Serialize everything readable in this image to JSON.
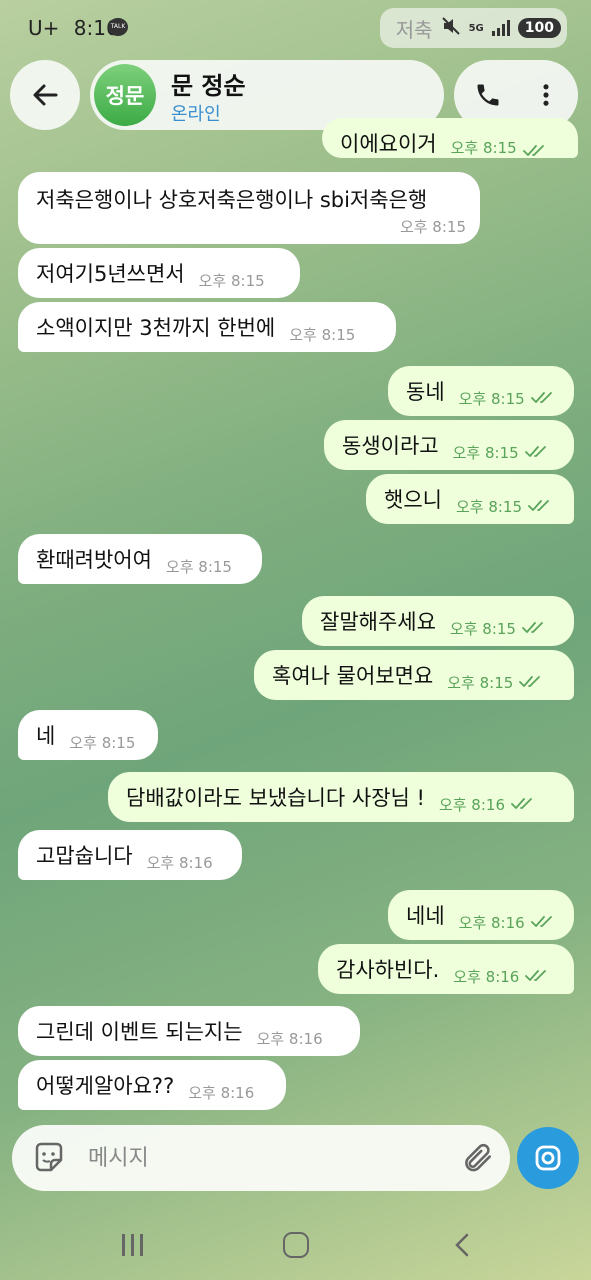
{
  "status_bar": {
    "carrier": "U+",
    "time": "8:16",
    "notification_icon": "talk-icon",
    "notification_text": "TALK",
    "app_label": "저축",
    "network": "5G",
    "battery": "100"
  },
  "header": {
    "avatar_text": "정문",
    "name": "문 정순",
    "status": "온라인"
  },
  "messages": [
    {
      "dir": "out",
      "text": "이에요이거",
      "time": "오후 8:15",
      "read": true
    },
    {
      "dir": "in",
      "text": "저축은행이나 상호저축은행이나 sbi저축은행",
      "time": "오후 8:15"
    },
    {
      "dir": "in",
      "text": "저여기5년쓰면서",
      "time": "오후 8:15"
    },
    {
      "dir": "in",
      "text": "소액이지만 3천까지 한번에",
      "time": "오후 8:15"
    },
    {
      "dir": "out",
      "text": "동네",
      "time": "오후 8:15",
      "read": true
    },
    {
      "dir": "out",
      "text": "동생이라고",
      "time": "오후 8:15",
      "read": true
    },
    {
      "dir": "out",
      "text": "햇으니",
      "time": "오후 8:15",
      "read": true
    },
    {
      "dir": "in",
      "text": "환때려밧어여",
      "time": "오후 8:15"
    },
    {
      "dir": "out",
      "text": "잘말해주세요",
      "time": "오후 8:15",
      "read": true
    },
    {
      "dir": "out",
      "text": "혹여나 물어보면요",
      "time": "오후 8:15",
      "read": true
    },
    {
      "dir": "in",
      "text": "네",
      "time": "오후 8:15"
    },
    {
      "dir": "out",
      "text": "담배값이라도 보냈습니다 사장님 !",
      "time": "오후 8:16",
      "read": true
    },
    {
      "dir": "in",
      "text": "고맙숩니다",
      "time": "오후 8:16"
    },
    {
      "dir": "out",
      "text": "네네",
      "time": "오후 8:16",
      "read": true
    },
    {
      "dir": "out",
      "text": "감사하빈다.",
      "time": "오후 8:16",
      "read": true
    },
    {
      "dir": "in",
      "text": "그린데 이벤트 되는지는",
      "time": "오후 8:16"
    },
    {
      "dir": "in",
      "text": "어떻게알아요??",
      "time": "오후 8:16"
    }
  ],
  "input": {
    "placeholder": "메시지"
  },
  "colors": {
    "incoming_bubble": "#ffffff",
    "outgoing_bubble": "#efffdc",
    "outgoing_time": "#5aa35a",
    "accent": "#2a9bdc",
    "status_online": "#3a8fd0",
    "avatar": "#3bab45"
  }
}
